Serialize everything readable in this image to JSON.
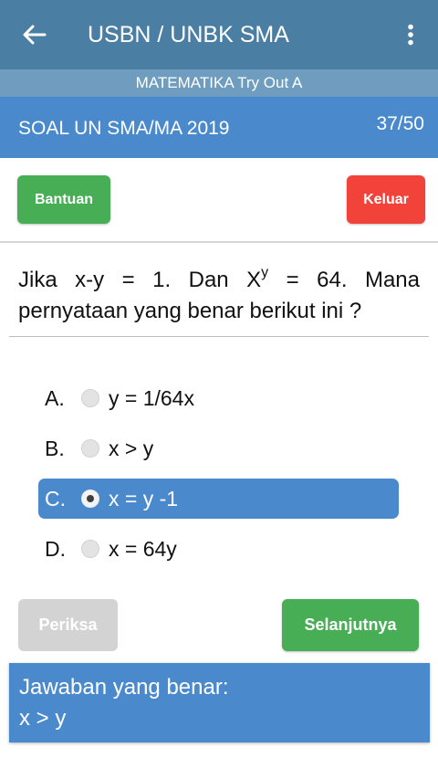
{
  "app_bar": {
    "title": "USBN / UNBK SMA",
    "back_icon": "arrow-left-icon",
    "menu_icon": "more-vertical-icon",
    "color": "#4a7ea3"
  },
  "sub_bar": {
    "subtitle": "MATEMATIKA Try Out A"
  },
  "info_bar": {
    "label": "SOAL UN SMA/MA 2019",
    "progress": "37/50",
    "color": "#4a8acc"
  },
  "actions": {
    "help_label": "Bantuan",
    "exit_label": "Keluar"
  },
  "question": {
    "part1": "Jika x-y = 1. Dan X",
    "superscript": "y",
    "part2": " = 64. Mana pernyataan yang benar berikut ini ?"
  },
  "options": [
    {
      "letter": "A.",
      "text": "y = 1/64x",
      "selected": false
    },
    {
      "letter": "B.",
      "text": "x > y",
      "selected": false
    },
    {
      "letter": "C.",
      "text": "x = y -1",
      "selected": true
    },
    {
      "letter": "D.",
      "text": "x = 64y",
      "selected": false
    }
  ],
  "footer": {
    "check_label": "Periksa",
    "next_label": "Selanjutnya"
  },
  "answer": {
    "title": "Jawaban yang benar:",
    "value": "x > y"
  }
}
